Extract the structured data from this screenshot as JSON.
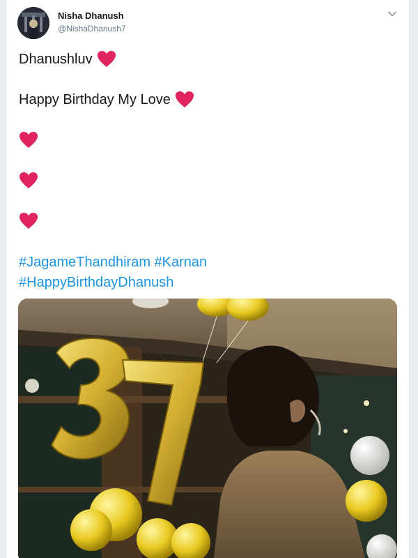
{
  "tweet": {
    "author_name": "Nisha Dhanush",
    "author_handle": "@NishaDhanush7",
    "lines": [
      "Dhanushluv",
      "Happy Birthday My Love"
    ],
    "hashtags": [
      "#JagameThandhiram #Karnan",
      "#HappyBirthdayDhanush"
    ],
    "media_alt": "Person facing gold 37 balloons"
  },
  "colors": {
    "heart": "#e0245e",
    "link": "#1b95e0",
    "name": "#14171a",
    "handle": "#657786"
  },
  "icons": {
    "menu": "chevron-down-icon",
    "heart": "red-heart-emoji"
  }
}
